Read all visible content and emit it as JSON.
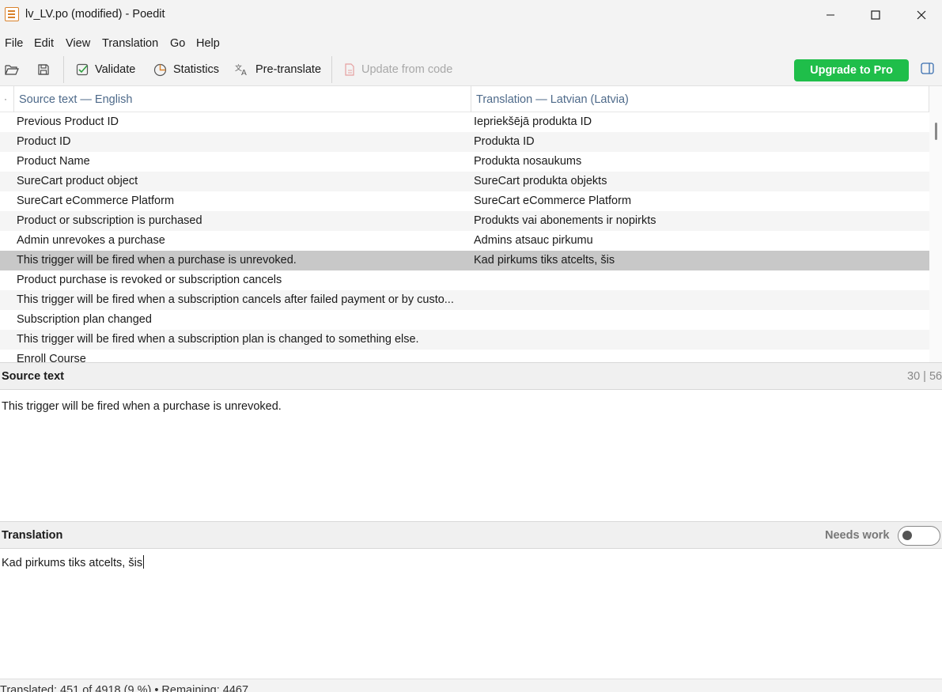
{
  "window": {
    "title": "lv_LV.po (modified) - Poedit",
    "app_icon": "poedit-doc-icon",
    "controls": [
      "minimize-icon",
      "maximize-icon",
      "close-icon"
    ]
  },
  "menu": [
    "File",
    "Edit",
    "View",
    "Translation",
    "Go",
    "Help"
  ],
  "toolbar": {
    "open_icon": "folder-open-icon",
    "save_icon": "save-icon",
    "validate": "Validate",
    "statistics": "Statistics",
    "pretranslate": "Pre-translate",
    "update_from_code": "Update from code",
    "upgrade": "Upgrade to Pro",
    "upgrade_color": "#1fbe4a",
    "sidebar_icon": "sidebar-toggle-icon"
  },
  "list": {
    "source_header": "Source text — English",
    "translation_header": "Translation — Latvian (Latvia)",
    "rows": [
      {
        "source": "Previous Product ID",
        "translation": "Iepriekšējā produkta ID"
      },
      {
        "source": "Product ID",
        "translation": "Produkta ID"
      },
      {
        "source": "Product Name",
        "translation": "Produkta nosaukums"
      },
      {
        "source": "SureCart product object",
        "translation": "SureCart produkta objekts"
      },
      {
        "source": "SureCart eCommerce Platform",
        "translation": "SureCart eCommerce Platform"
      },
      {
        "source": "Product or subscription is purchased",
        "translation": "Produkts vai abonements ir nopirkts"
      },
      {
        "source": "Admin unrevokes a purchase",
        "translation": "Admins atsauc pirkumu"
      },
      {
        "source": "This trigger will be fired when a purchase is unrevoked.",
        "translation": "Kad pirkums tiks atcelts, šis"
      },
      {
        "source": "Product purchase is revoked or subscription cancels",
        "translation": ""
      },
      {
        "source": "This trigger will be fired when a subscription cancels after failed payment or by custo...",
        "translation": ""
      },
      {
        "source": "Subscription plan changed",
        "translation": ""
      },
      {
        "source": "This trigger will be fired when a subscription plan is changed to something else.",
        "translation": ""
      },
      {
        "source": "Enroll Course",
        "translation": ""
      }
    ]
  },
  "source_panel": {
    "title": "Source text",
    "counter": "30 | 56",
    "text": "This trigger will be fired when a purchase is unrevoked."
  },
  "translation_panel": {
    "title": "Translation",
    "needs_work": "Needs work",
    "needs_work_on": false,
    "text": "Kad pirkums tiks atcelts, šis"
  },
  "status": "Translated: 451 of 4918 (9 %)  •  Remaining: 4467"
}
